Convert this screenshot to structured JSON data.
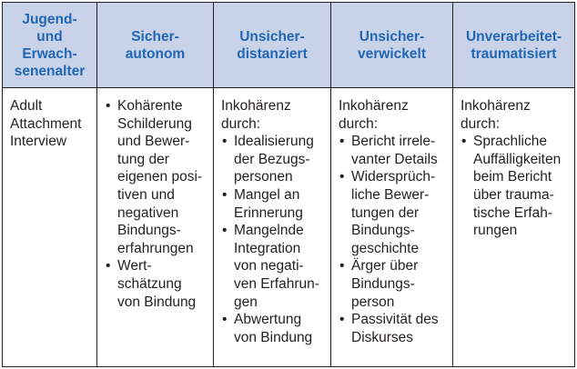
{
  "headers": [
    "Jugend-\nund\nErwach-\nsenenalter",
    "Sicher-\nautonom",
    "Unsicher-\ndistanziert",
    "Unsicher-\nverwickelt",
    "Unverarbeitet-\ntraumatisiert"
  ],
  "row": {
    "col1": "Adult\nAttachment\nInterview",
    "col2_bullets": [
      "Kohärente\nSchilderung\nund Bewer-\ntung der\neigenen posi-\ntiven und\nnegativen\nBindungs-\nerfahrungen",
      "Wert-\nschätzung\nvon Bindung"
    ],
    "col3_intro": "Inkohärenz\ndurch:",
    "col3_bullets": [
      "Idealisierung\nder Bezugs-\npersonen",
      "Mangel an\nErinnerung",
      "Mangelnde\nIntegration\nvon negati-\nven Erfahrun-\ngen",
      "Abwertung\nvon Bindung"
    ],
    "col4_intro": "Inkohärenz\ndurch:",
    "col4_bullets": [
      "Bericht irrele-\nvanter Details",
      "Widersprüch-\nliche Bewer-\ntungen der\nBindungs-\ngeschichte",
      "Ärger über\nBindungs-\nperson",
      "Passivität des\nDiskurses"
    ],
    "col5_intro": "Inkohärenz\ndurch:",
    "col5_bullets": [
      "Sprachliche\nAuffälligkeiten\nbeim Bericht\nüber trauma-\ntische Erfah-\nrungen"
    ]
  },
  "colors": {
    "header_bg": "#c8d3e9",
    "header_text": "#2266b4",
    "border": "#231f20"
  }
}
